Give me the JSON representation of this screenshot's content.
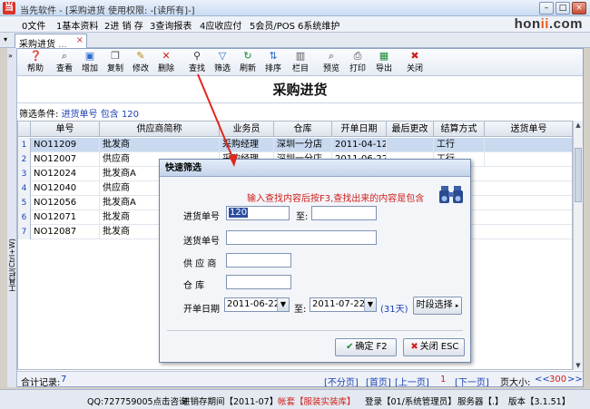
{
  "window": {
    "logo_char": "当",
    "title": "当先软件 - [采购进货  使用权限: -[读所有]-]",
    "min": "–",
    "max": "□",
    "close": "×"
  },
  "menu": [
    "0文件",
    "1基本资料",
    "2进 销 存",
    "3查询报表",
    "4应收应付",
    "5会员/POS",
    "6系统维护"
  ],
  "brand": {
    "pre": "hon",
    "accent": "ii",
    "post": ".com"
  },
  "tab": {
    "label": "采购进货",
    "dots": "...",
    "close": "×"
  },
  "toolbar": [
    {
      "label": "帮助",
      "icon": "help-icon"
    },
    {
      "label": "查看",
      "icon": "view-icon"
    },
    {
      "label": "增加",
      "icon": "add-icon"
    },
    {
      "label": "复制",
      "icon": "copy-icon"
    },
    {
      "label": "修改",
      "icon": "edit-icon"
    },
    {
      "label": "删除",
      "icon": "delete-icon"
    },
    {
      "label": "查找",
      "icon": "find-icon"
    },
    {
      "label": "筛选",
      "icon": "filter-icon"
    },
    {
      "label": "刷新",
      "icon": "refresh-icon"
    },
    {
      "label": "排序",
      "icon": "sort-icon"
    },
    {
      "label": "栏目",
      "icon": "columns-icon"
    },
    {
      "label": "预览",
      "icon": "preview-icon"
    },
    {
      "label": "打印",
      "icon": "print-icon"
    },
    {
      "label": "导出",
      "icon": "export-icon"
    },
    {
      "label": "关闭",
      "icon": "close-icon"
    }
  ],
  "page_title": "采购进货",
  "filter": {
    "label": "筛选条件:",
    "field": "进货单号",
    "op": "包含",
    "value": "120"
  },
  "left_strip_text": "工具栏(Ctrl+W)",
  "grid": {
    "columns": [
      "单号",
      "供应商简称",
      "业务员",
      "仓库",
      "开单日期",
      "最后更改",
      "结算方式",
      "送货单号"
    ],
    "rows": [
      {
        "n": "1",
        "cells": [
          "NO11209",
          "批发商",
          "采购经理",
          "深圳一分店",
          "2011-04-12",
          "",
          "工行",
          ""
        ]
      },
      {
        "n": "2",
        "cells": [
          "NO12007",
          "供应商",
          "采购经理",
          "深圳一分店",
          "2011-06-22",
          "",
          "工行",
          ""
        ]
      },
      {
        "n": "3",
        "cells": [
          "NO12024",
          "批发商A",
          "",
          "",
          "",
          "",
          "",
          ""
        ]
      },
      {
        "n": "4",
        "cells": [
          "NO12040",
          "供应商",
          "",
          "",
          "",
          "",
          "",
          ""
        ]
      },
      {
        "n": "5",
        "cells": [
          "NO12056",
          "批发商A",
          "",
          "",
          "",
          "",
          "",
          ""
        ]
      },
      {
        "n": "6",
        "cells": [
          "NO12071",
          "批发商",
          "",
          "",
          "",
          "",
          "",
          ""
        ]
      },
      {
        "n": "7",
        "cells": [
          "NO12087",
          "批发商",
          "",
          "",
          "",
          "",
          "",
          ""
        ]
      }
    ]
  },
  "pager": {
    "total_label": "合计记录:",
    "total": "7",
    "no_paging": "[不分页]",
    "first": "[首页]",
    "prev": "[上一页]",
    "current": "1",
    "next": "[下一页]",
    "page_size_label": "页大小:",
    "nav_back": "<<",
    "page_size": "300",
    "nav_fwd": ">>"
  },
  "status": {
    "qq": "QQ:727759005点击咨询",
    "period": "进销存期间【2011-07】",
    "account": "帐套【服装实装库】",
    "login": "登录【01/系统管理员】",
    "server": "服务器【.】",
    "version": "版本【3.1.51】"
  },
  "dialog": {
    "title": "快速筛选",
    "hint": "输入查找内容后按F3,查找出来的内容是包含",
    "order_no_label": "进货单号",
    "order_no_from": "120",
    "to_label": "至:",
    "order_no_to": "",
    "delivery_label": "送货单号",
    "delivery_value": "",
    "supplier_label": "供 应 商",
    "supplier_value": "",
    "warehouse_label": "仓    库",
    "warehouse_value": "",
    "date_label": "开单日期",
    "date_from": "2011-06-22",
    "date_to": "2011-07-22",
    "days": "(31天)",
    "period_btn": "时段选择",
    "ok_btn": "确定 F2",
    "cancel_btn": "关闭 ESC"
  },
  "colors": {
    "accent": "#1b3fb5",
    "alert": "#d0201a",
    "selection": "#c9d9f0"
  }
}
